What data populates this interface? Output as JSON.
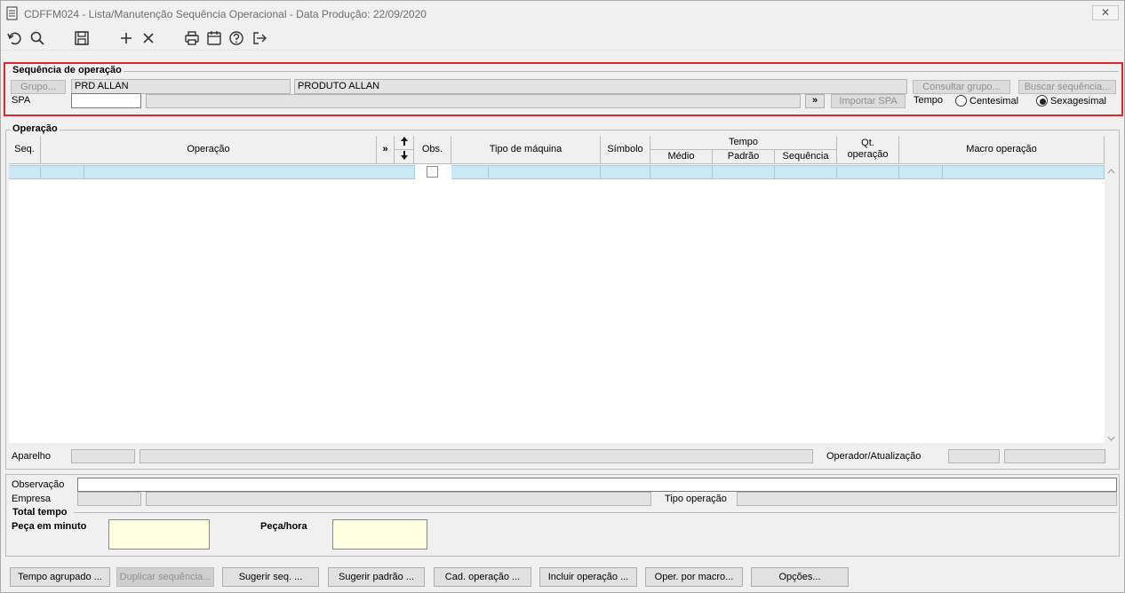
{
  "window": {
    "title": "CDFFM024 - Lista/Manutenção Sequência Operacional - Data Produção: 22/09/2020",
    "close_label": "✕"
  },
  "toolbar": {
    "icons": [
      "undo-icon",
      "search-icon",
      "save-icon",
      "add-icon",
      "delete-icon",
      "print-icon",
      "calendar-icon",
      "help-icon",
      "exit-icon"
    ]
  },
  "sequencia": {
    "legend": "Sequência de operação",
    "grupo_button": "Grupo...",
    "grupo_code": "PRD ALLAN",
    "grupo_desc": "PRODUTO ALLAN",
    "consultar_grupo_button": "Consultar grupo...",
    "buscar_sequencia_button": "Buscar sequência...",
    "spa_label": "SPA",
    "spa_value": "",
    "spa_desc": "",
    "more_button": "»",
    "importar_spa_button": "Importar SPA",
    "tempo_label": "Tempo",
    "centesimal_label": "Centesimal",
    "sexagesimal_label": "Sexagesimal",
    "tempo_selected": "Sexagesimal"
  },
  "operacao": {
    "legend": "Operação",
    "headers": {
      "seq": "Seq.",
      "operacao": "Operação",
      "more": "»",
      "obs": "Obs.",
      "tipo_maquina": "Tipo de máquina",
      "simbolo": "Símbolo",
      "tempo": "Tempo",
      "medio": "Médio",
      "padrao": "Padrão",
      "sequencia": "Sequência",
      "qt_operacao_1": "Qt.",
      "qt_operacao_2": "operação",
      "macro_operacao": "Macro operação"
    },
    "aparelho_label": "Aparelho",
    "operador_label": "Operador/Atualização"
  },
  "observacao": {
    "observacao_label": "Observação",
    "empresa_label": "Empresa",
    "tipo_operacao_label": "Tipo operação"
  },
  "total": {
    "legend": "Total tempo",
    "peca_minuto_label": "Peça em minuto",
    "peca_hora_label": "Peça/hora"
  },
  "buttons": {
    "tempo_agrupado": "Tempo agrupado ...",
    "duplicar_sequencia": "Duplicar sequência...",
    "sugerir_seq": "Sugerir seq. ...",
    "sugerir_padrao": "Sugerir padrão ...",
    "cad_operacao": "Cad. operação ...",
    "incluir_operacao": "Incluir operação ...",
    "oper_por_macro": "Oper. por macro...",
    "opcoes": "Opções..."
  }
}
